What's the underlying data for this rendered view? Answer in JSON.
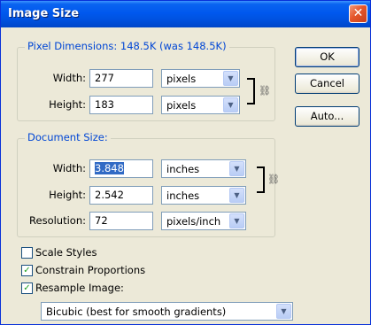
{
  "window": {
    "title": "Image Size"
  },
  "pixel_dimensions": {
    "legend": "Pixel Dimensions:  148.5K (was 148.5K)",
    "width_label": "Width:",
    "width_value": "277",
    "width_unit": "pixels",
    "height_label": "Height:",
    "height_value": "183",
    "height_unit": "pixels"
  },
  "document_size": {
    "legend": "Document Size:",
    "width_label": "Width:",
    "width_value": "3.848",
    "width_unit": "inches",
    "height_label": "Height:",
    "height_value": "2.542",
    "height_unit": "inches",
    "resolution_label": "Resolution:",
    "resolution_value": "72",
    "resolution_unit": "pixels/inch"
  },
  "options": {
    "scale_styles": {
      "label": "Scale Styles",
      "checked": false
    },
    "constrain_proportions": {
      "label": "Constrain Proportions",
      "checked": true
    },
    "resample_image": {
      "label": "Resample Image:",
      "checked": true
    },
    "resample_method": "Bicubic (best for smooth gradients)"
  },
  "buttons": {
    "ok": "OK",
    "cancel": "Cancel",
    "auto": "Auto..."
  },
  "icons": {
    "close": "close-icon",
    "link": "chain-link-icon",
    "dropdown": "chevron-down-icon",
    "check": "checkmark-icon"
  },
  "colors": {
    "titlebar": "#0058ee",
    "legend_text": "#0046d5",
    "dialog_bg": "#ece9d8",
    "selection": "#316ac5"
  }
}
